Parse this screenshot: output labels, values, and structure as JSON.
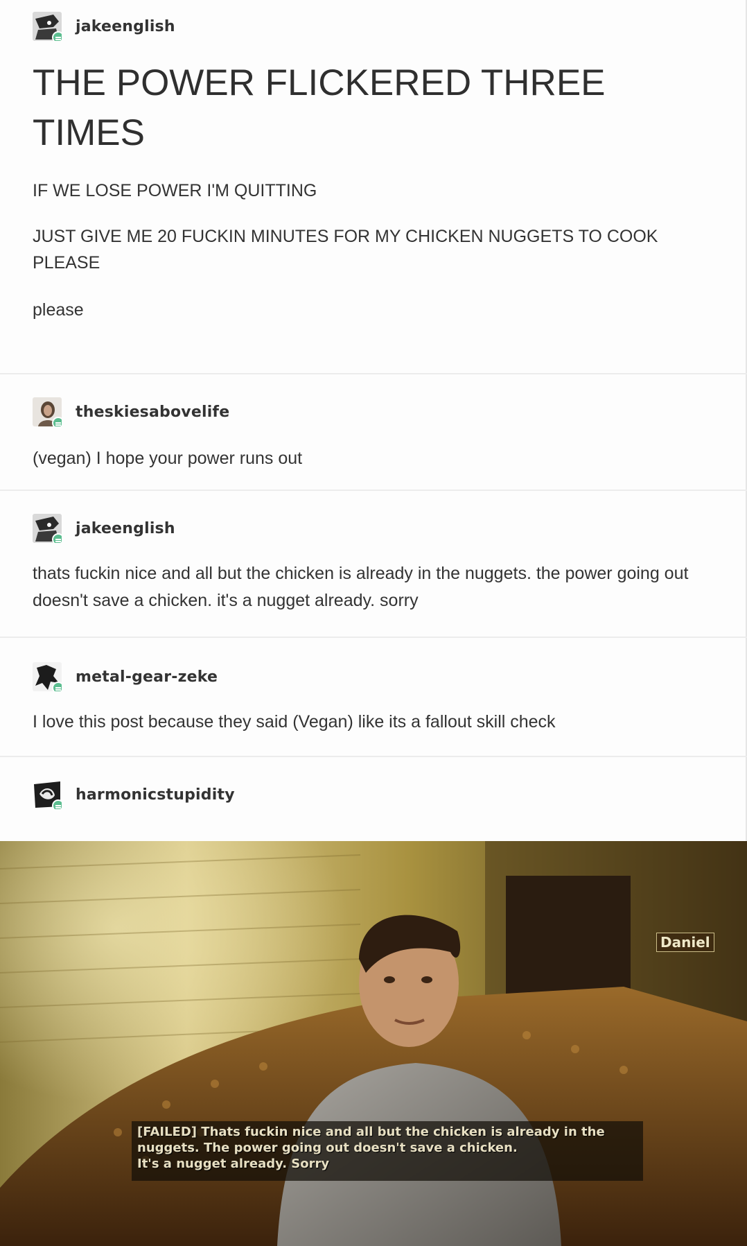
{
  "posts": [
    {
      "username": "jakeenglish",
      "avatar_icon": "dark-character-avatar-icon",
      "title": "THE POWER FLICKERED THREE TIMES",
      "paragraphs": [
        "IF WE LOSE POWER I'M QUITTING",
        "JUST GIVE ME 20 FUCKIN MINUTES FOR MY CHICKEN NUGGETS TO COOK PLEASE",
        "please"
      ]
    },
    {
      "username": "theskiesabovelife",
      "avatar_icon": "person-photo-avatar-icon",
      "text": "(vegan) I hope your power runs out"
    },
    {
      "username": "jakeenglish",
      "avatar_icon": "dark-character-avatar-icon",
      "text": "thats fuckin nice and all but the chicken is already in the nuggets. the power going out doesn't save a chicken. it's a nugget already. sorry"
    },
    {
      "username": "metal-gear-zeke",
      "avatar_icon": "dark-silhouette-avatar-icon",
      "text": "I love this post because they said (Vegan) like its a fallout skill check"
    },
    {
      "username": "harmonicstupidity",
      "avatar_icon": "black-white-sketch-avatar-icon"
    }
  ],
  "image": {
    "speaker_tag": "Daniel",
    "subtitle_lines": [
      "[FAILED] Thats fuckin nice and all but the chicken is already in the",
      "nuggets. The power going out doesn't save a chicken.",
      "It's a nugget already. Sorry"
    ]
  },
  "colors": {
    "reblog_badge": "#5bbd8f",
    "divider": "#ececec",
    "text": "#333333"
  }
}
